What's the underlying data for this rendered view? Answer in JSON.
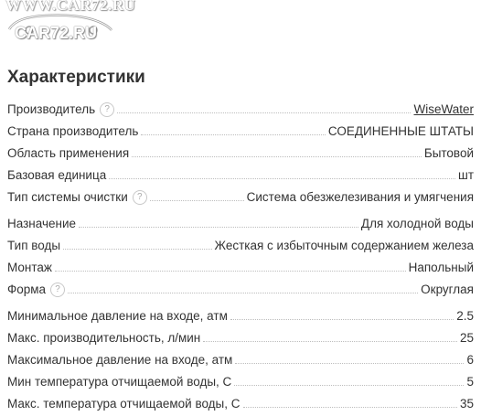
{
  "watermark": {
    "url": "WWW.CAR72.RU",
    "logo": "CAR72.RU"
  },
  "section": {
    "title": "Характеристики",
    "help_glyph": "?"
  },
  "specs": [
    [
      {
        "name": "Производитель",
        "value": "WiseWater",
        "help": true,
        "link": true
      },
      {
        "name": "Страна производитель",
        "value": "СОЕДИНЕННЫЕ ШТАТЫ",
        "help": false,
        "link": false
      },
      {
        "name": "Область применения",
        "value": "Бытовой",
        "help": false,
        "link": false
      },
      {
        "name": "Базовая единица",
        "value": "шт",
        "help": false,
        "link": false
      },
      {
        "name": "Тип системы очистки",
        "value": "Система обезжелезивания и умягчения",
        "help": true,
        "link": false
      }
    ],
    [
      {
        "name": "Назначение",
        "value": "Для холодной воды",
        "help": false,
        "link": false
      },
      {
        "name": "Тип воды",
        "value": "Жесткая с избыточным содержанием железа",
        "help": false,
        "link": false
      },
      {
        "name": "Монтаж",
        "value": "Напольный",
        "help": false,
        "link": false
      },
      {
        "name": "Форма",
        "value": "Округлая",
        "help": true,
        "link": false
      }
    ],
    [
      {
        "name": "Минимальное давление на входе, атм",
        "value": "2.5",
        "help": false,
        "link": false
      },
      {
        "name": "Макс. производительность, л/мин",
        "value": "25",
        "help": false,
        "link": false
      },
      {
        "name": "Максимальное давление на входе, атм",
        "value": "6",
        "help": false,
        "link": false
      },
      {
        "name": "Мин температура отчищаемой воды, С",
        "value": "5",
        "help": false,
        "link": false
      },
      {
        "name": "Макс. температура отчищаемой воды, С",
        "value": "35",
        "help": false,
        "link": false
      }
    ]
  ]
}
